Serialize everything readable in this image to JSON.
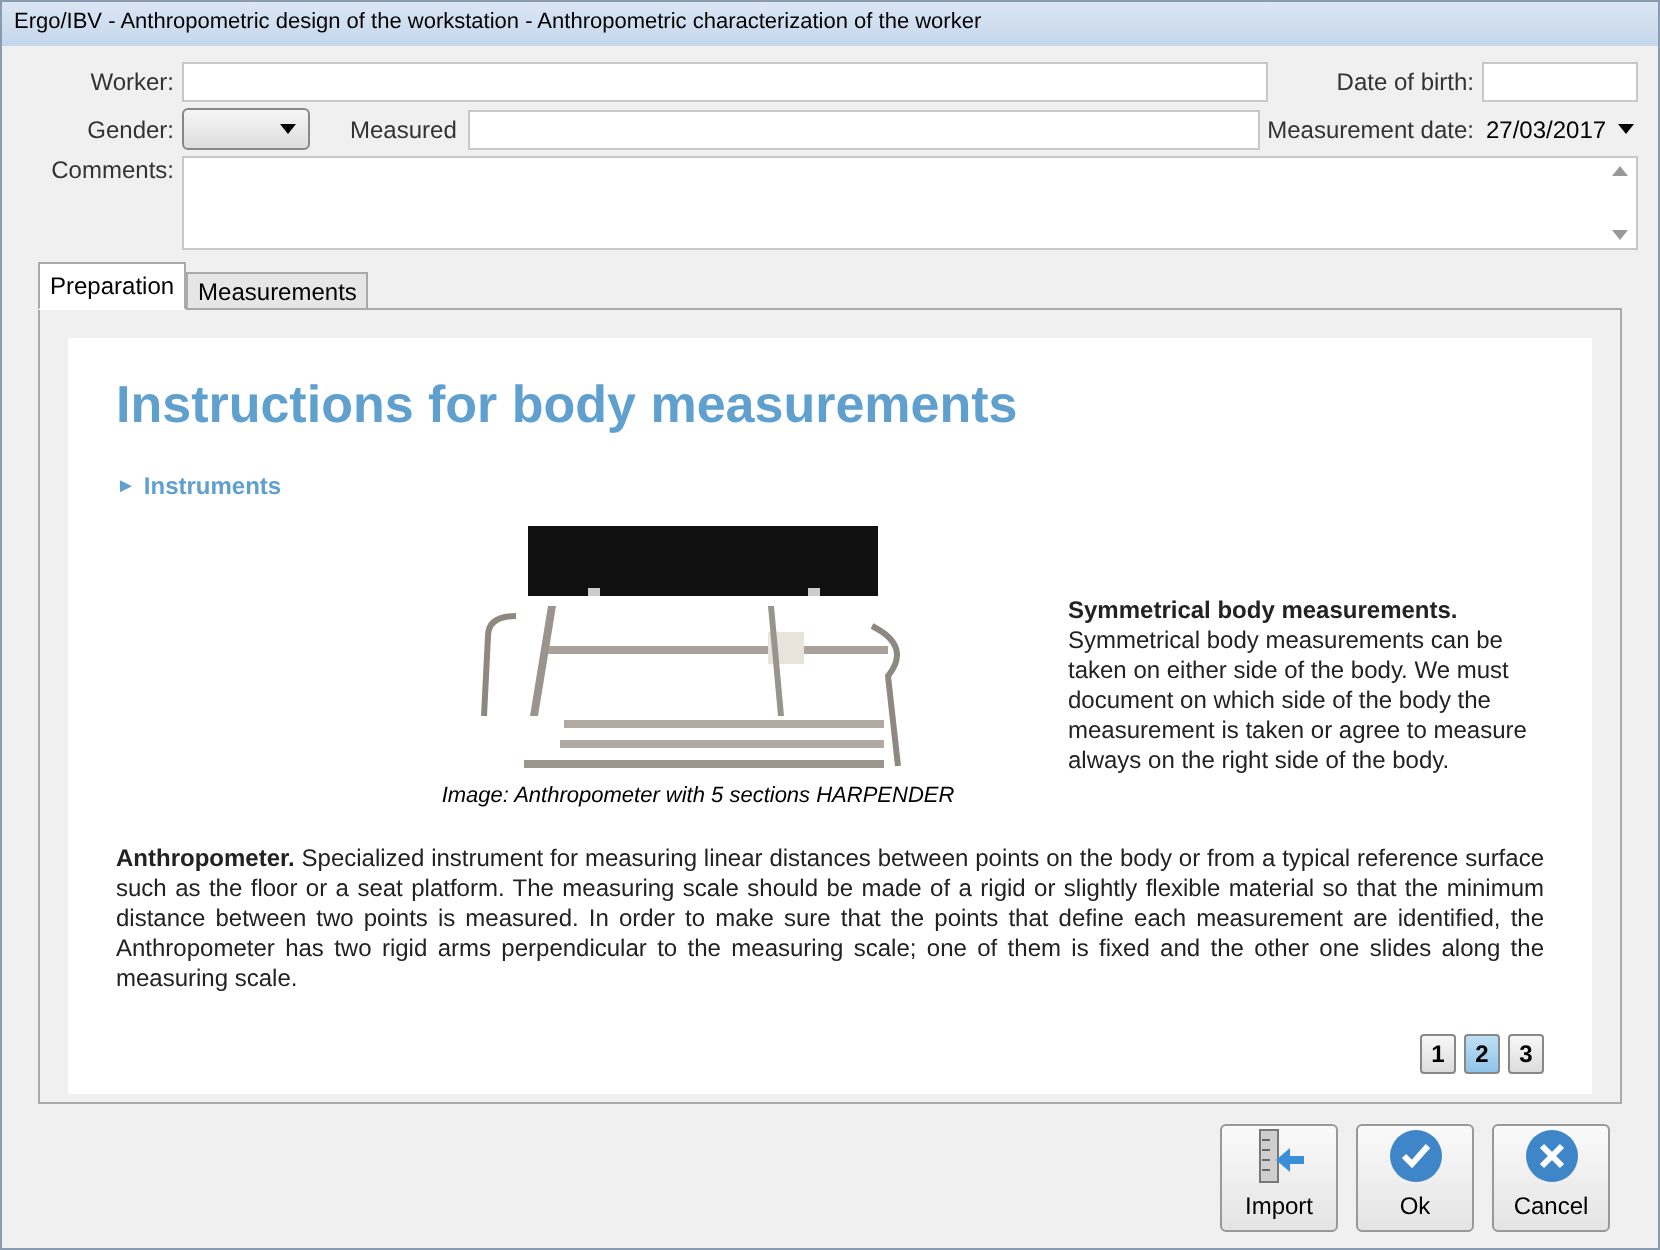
{
  "window": {
    "title": "Ergo/IBV - Anthropometric design of the workstation - Anthropometric characterization of the worker"
  },
  "form": {
    "worker_label": "Worker:",
    "date_of_birth_label": "Date of birth:",
    "gender_label": "Gender:",
    "measured_label": "Measured",
    "measurement_date_label": "Measurement date:",
    "measurement_date": "27/03/2017",
    "comments_label": "Comments:"
  },
  "tabs": [
    {
      "label": "Preparation",
      "selected": true
    },
    {
      "label": "Measurements",
      "selected": false
    }
  ],
  "content": {
    "heading": "Instructions for body measurements",
    "section": "Instruments",
    "section_marker": "►",
    "caption": "Image: Anthropometer with 5 sections HARPENDER",
    "side_text": "**Symmetrical body measurements.** Symmetrical body measurements can be taken on either side of the body. We must document on which side of the body the measurement is taken or agree to measure always on the right side of the body.",
    "paragraph": "**Anthropometer.** Specialized instrument for measuring linear distances between points on the body or from a typical reference surface such as the floor or a seat platform. The measuring scale should be made of a rigid or slightly flexible material so that the minimum distance between two points is measured. In order to make sure that the points that define each measurement are identified, the Anthropometer has two rigid arms perpendicular to the measuring scale; one of them is fixed and the other one slides along the measuring scale."
  },
  "pages": [
    {
      "label": "1",
      "selected": false
    },
    {
      "label": "2",
      "selected": true
    },
    {
      "label": "3",
      "selected": false
    }
  ],
  "buttons": [
    {
      "kind": "import",
      "label": "Import"
    },
    {
      "kind": "ok",
      "label": "Ok"
    },
    {
      "kind": "cancel",
      "label": "Cancel"
    }
  ]
}
